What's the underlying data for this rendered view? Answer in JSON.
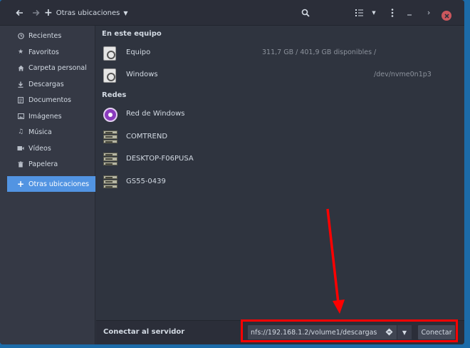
{
  "header": {
    "location_label": "Otras ubicaciones",
    "icons": [
      "back-icon",
      "forward-icon",
      "search-icon",
      "list-view-icon",
      "view-options-icon",
      "menu-icon",
      "minimize-icon",
      "maximize-icon",
      "close-icon"
    ]
  },
  "sidebar": {
    "items": [
      {
        "label": "Recientes",
        "icon": "clock-icon"
      },
      {
        "label": "Favoritos",
        "icon": "star-icon"
      },
      {
        "label": "Carpeta personal",
        "icon": "home-icon"
      },
      {
        "label": "Descargas",
        "icon": "download-icon"
      },
      {
        "label": "Documentos",
        "icon": "document-icon"
      },
      {
        "label": "Imágenes",
        "icon": "image-icon"
      },
      {
        "label": "Música",
        "icon": "music-icon"
      },
      {
        "label": "Vídeos",
        "icon": "video-icon"
      },
      {
        "label": "Papelera",
        "icon": "trash-icon"
      }
    ],
    "other_locations": {
      "label": "Otras ubicaciones",
      "icon": "plus-icon"
    }
  },
  "main": {
    "this_computer": {
      "title": "En este equipo",
      "items": [
        {
          "name": "Equipo",
          "space": "311,7 GB / 401,9 GB disponibles",
          "path": "/"
        },
        {
          "name": "Windows",
          "space": "",
          "path": "/dev/nvme0n1p3"
        }
      ]
    },
    "networks": {
      "title": "Redes",
      "items": [
        {
          "name": "Red de Windows",
          "icon": "windows-network-icon"
        },
        {
          "name": "COMTREND",
          "icon": "server-icon"
        },
        {
          "name": "DESKTOP-F06PUSA",
          "icon": "server-icon"
        },
        {
          "name": "GS55-0439",
          "icon": "server-icon"
        }
      ]
    }
  },
  "bottom": {
    "label": "Conectar al servidor",
    "server_value": "nfs://192.168.1.2/volume1/descargas",
    "connect_label": "Conectar"
  },
  "colors": {
    "accent": "#5294e2",
    "annotation": "#ff0000",
    "desktop": "#1c6ba8"
  }
}
